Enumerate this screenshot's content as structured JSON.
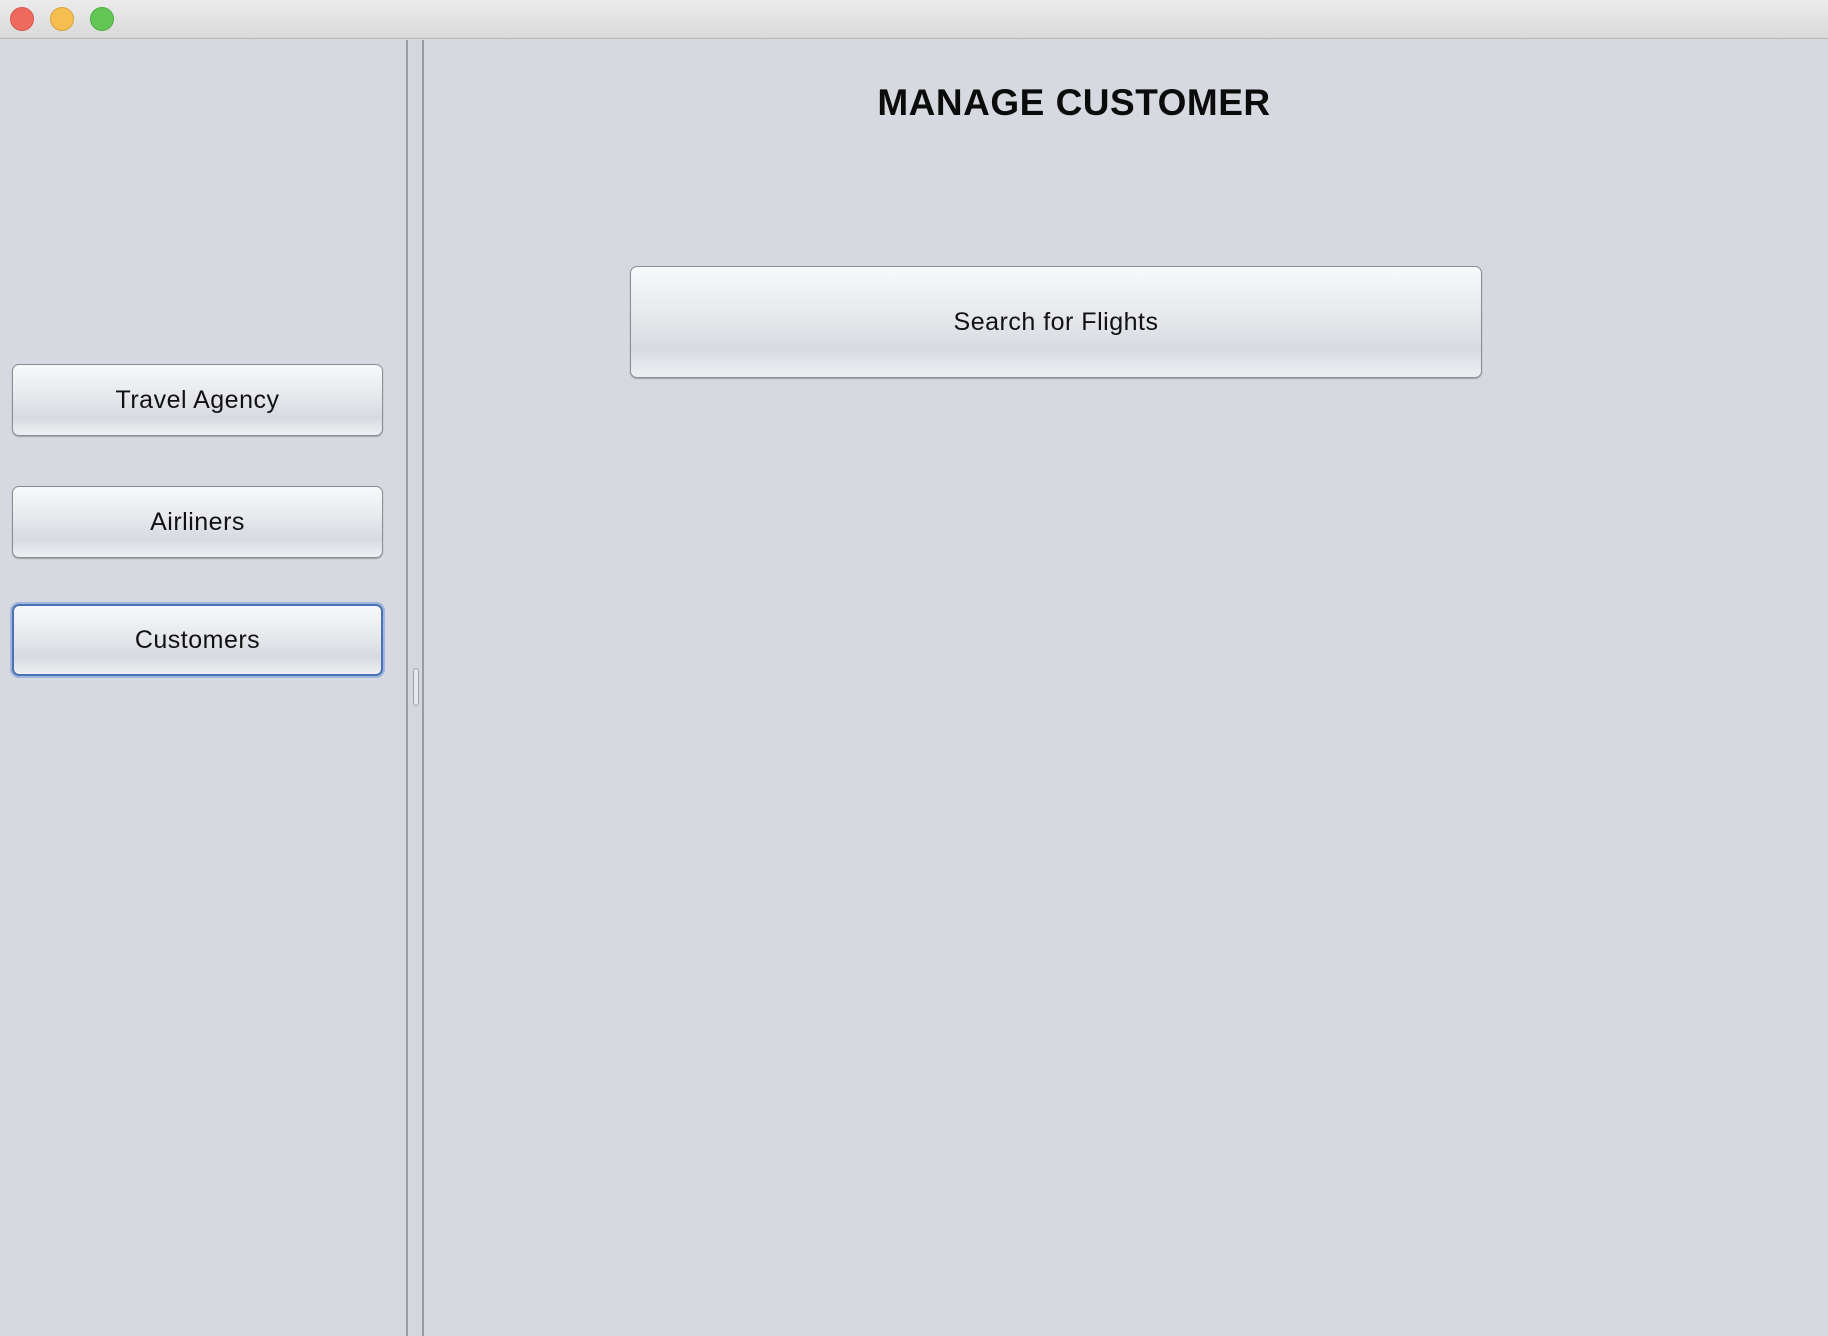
{
  "window": {
    "controls": [
      "close",
      "minimize",
      "zoom"
    ]
  },
  "sidebar": {
    "buttons": [
      {
        "label": "Travel Agency"
      },
      {
        "label": "Airliners"
      },
      {
        "label": "Customers",
        "focused": true
      }
    ]
  },
  "main": {
    "title": "MANAGE CUSTOMER",
    "search_button_label": "Search for Flights"
  }
}
